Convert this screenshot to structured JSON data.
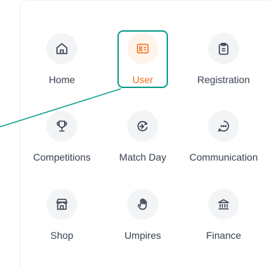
{
  "colors": {
    "accent": "#f37021",
    "highlight": "#109e8a",
    "icon": "#374151",
    "icon_bg": "#f3f4f6"
  },
  "menu": {
    "items": [
      {
        "label": "Home",
        "icon": "home-icon"
      },
      {
        "label": "User",
        "icon": "user-id-card-icon",
        "active": true
      },
      {
        "label": "Registration",
        "icon": "clipboard-icon"
      },
      {
        "label": "Competitions",
        "icon": "trophy-icon"
      },
      {
        "label": "Match Day",
        "icon": "match-day-icon"
      },
      {
        "label": "Communication",
        "icon": "chat-bubble-icon"
      },
      {
        "label": "Shop",
        "icon": "shop-icon"
      },
      {
        "label": "Umpires",
        "icon": "hand-icon"
      },
      {
        "label": "Finance",
        "icon": "bank-icon"
      }
    ]
  }
}
